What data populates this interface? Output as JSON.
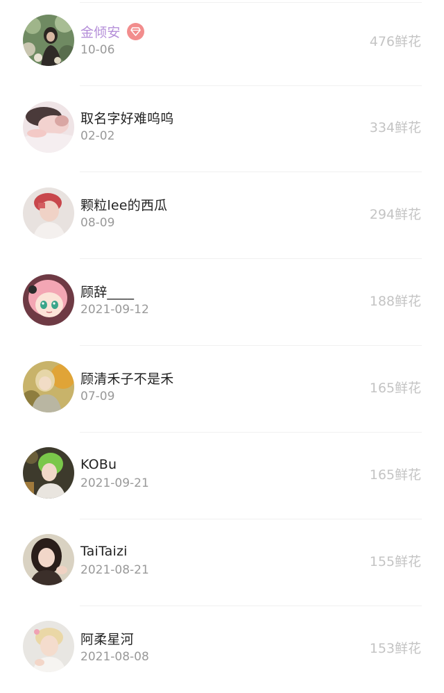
{
  "rows": [
    {
      "name": "金倾安",
      "date": "10-06",
      "flowers": "476鲜花",
      "vip": true,
      "name_color": "#b58fd9",
      "avatar_icon": "avatar-girl-garden"
    },
    {
      "name": "取名字好难呜呜",
      "date": "02-02",
      "flowers": "334鲜花",
      "vip": false,
      "avatar_icon": "avatar-sleeping-girl"
    },
    {
      "name": "颗粒lee的西瓜",
      "date": "08-09",
      "flowers": "294鲜花",
      "vip": false,
      "avatar_icon": "avatar-red-hair-girl"
    },
    {
      "name": "顾辞____",
      "date": "2021-09-12",
      "flowers": "188鲜花",
      "vip": false,
      "avatar_icon": "avatar-anime-girl"
    },
    {
      "name": "顾清禾子不是禾",
      "date": "07-09",
      "flowers": "165鲜花",
      "vip": false,
      "avatar_icon": "avatar-golden-girl"
    },
    {
      "name": "KOBu",
      "date": "2021-09-21",
      "flowers": "165鲜花",
      "vip": false,
      "avatar_icon": "avatar-green-hair-girl"
    },
    {
      "name": "TaiTaizi",
      "date": "2021-08-21",
      "flowers": "155鲜花",
      "vip": false,
      "avatar_icon": "avatar-dark-hair-girl"
    },
    {
      "name": "阿柔星河",
      "date": "2021-08-08",
      "flowers": "153鲜花",
      "vip": false,
      "avatar_icon": "avatar-blond-boy"
    }
  ],
  "colors": {
    "vip_badge": "#f28d8d",
    "date_text": "#999999",
    "flower_text": "#c4c4c4",
    "divider": "#f0f0f0"
  }
}
